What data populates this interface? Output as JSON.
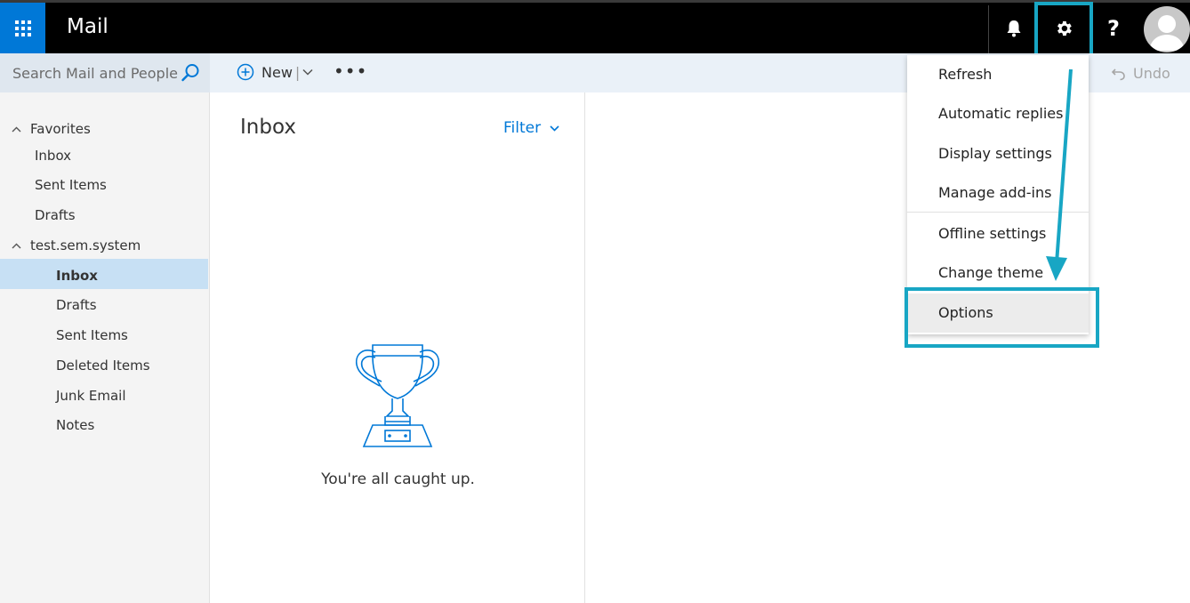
{
  "header": {
    "app_title": "Mail",
    "waffle_icon": "app-launcher-icon",
    "bell_icon": "bell-icon",
    "gear_icon": "gear-icon",
    "help_label": "?",
    "avatar_icon": "user-avatar-icon"
  },
  "toolbar": {
    "search_placeholder": "Search Mail and People",
    "new_label": "New",
    "more_label": "•••",
    "undo_label": "Undo"
  },
  "sidebar": {
    "favorites": {
      "label": "Favorites",
      "items": [
        {
          "label": "Inbox"
        },
        {
          "label": "Sent Items"
        },
        {
          "label": "Drafts"
        }
      ]
    },
    "account": {
      "label": "test.sem.system",
      "items": [
        {
          "label": "Inbox",
          "selected": true
        },
        {
          "label": "Drafts"
        },
        {
          "label": "Sent Items"
        },
        {
          "label": "Deleted Items"
        },
        {
          "label": "Junk Email"
        },
        {
          "label": "Notes"
        }
      ]
    }
  },
  "message_list": {
    "title": "Inbox",
    "filter_label": "Filter",
    "empty_message": "You're all caught up."
  },
  "settings_menu": {
    "items": [
      {
        "label": "Refresh"
      },
      {
        "label": "Automatic replies"
      },
      {
        "label": "Display settings"
      },
      {
        "label": "Manage add-ins"
      },
      {
        "label": "Offline settings"
      },
      {
        "label": "Change theme"
      },
      {
        "label": "Options",
        "highlighted": true
      }
    ]
  },
  "colors": {
    "brand": "#0078d7",
    "highlight_annotation": "#18a6c4",
    "selected_row": "#c7e0f4"
  }
}
